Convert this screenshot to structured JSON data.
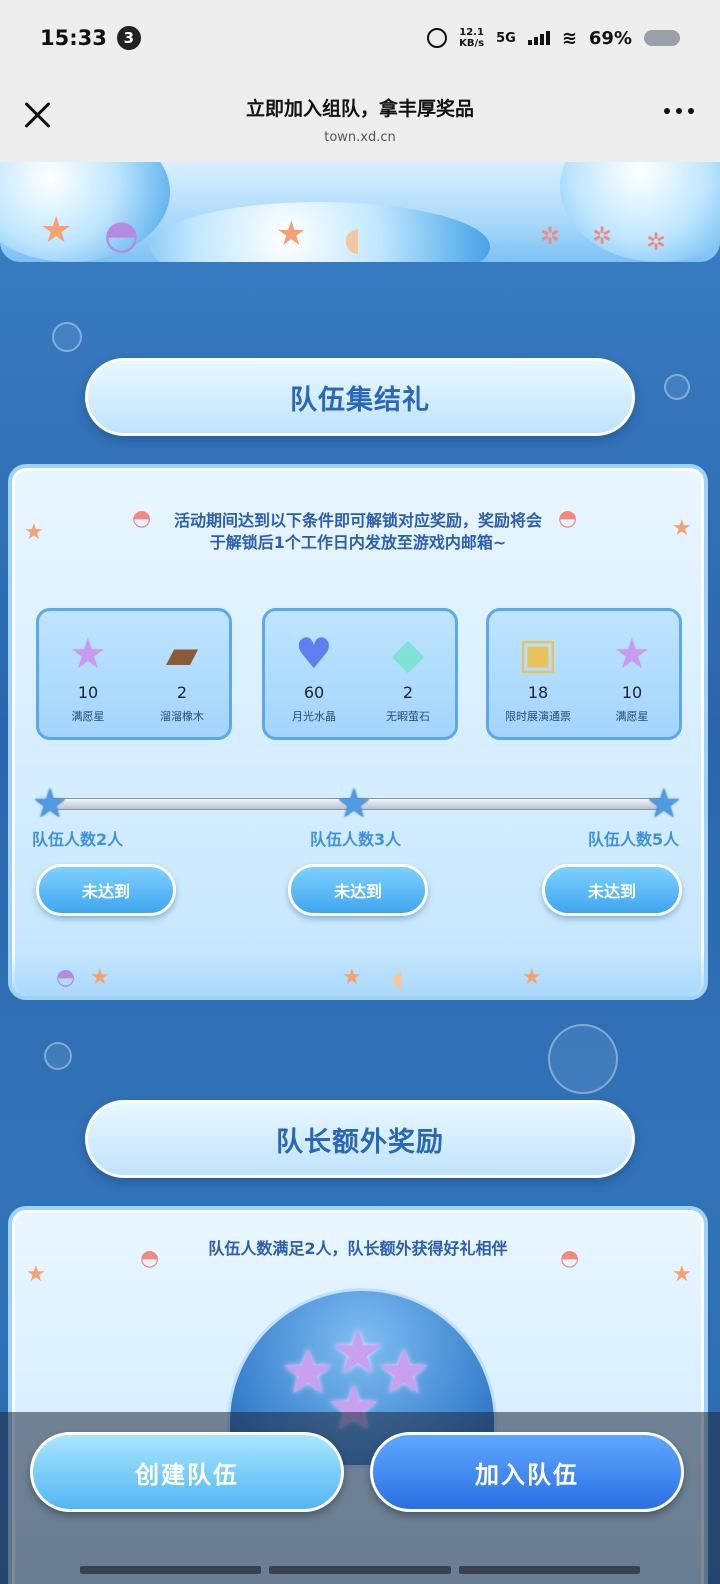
{
  "status_bar": {
    "time": "15:33",
    "notification_count": "3",
    "net_speed_value": "12.1",
    "net_speed_unit": "KB/s",
    "network": "5G",
    "battery": "69%"
  },
  "title_bar": {
    "title": "立即加入组队，拿丰厚奖品",
    "url": "town.xd.cn"
  },
  "gathering_section": {
    "title": "队伍集结礼",
    "description_line1": "活动期间达到以下条件即可解锁对应奖励，奖励将会",
    "description_line2": "于解锁后1个工作日内发放至游戏内邮箱~",
    "tiers": [
      {
        "items": [
          {
            "count": "10",
            "name": "满愿星",
            "icon": "purple-star-icon"
          },
          {
            "count": "2",
            "name": "溜溜橡木",
            "icon": "oak-log-icon"
          }
        ],
        "requirement": "队伍人数2人",
        "status": "未达到"
      },
      {
        "items": [
          {
            "count": "60",
            "name": "月光水晶",
            "icon": "heart-crystal-icon"
          },
          {
            "count": "2",
            "name": "无暇萤石",
            "icon": "gem-icon"
          }
        ],
        "requirement": "队伍人数3人",
        "status": "未达到"
      },
      {
        "items": [
          {
            "count": "18",
            "name": "限时展演通票",
            "icon": "ticket-icon"
          },
          {
            "count": "10",
            "name": "满愿星",
            "icon": "purple-star-icon"
          }
        ],
        "requirement": "队伍人数5人",
        "status": "未达到"
      }
    ]
  },
  "captain_section": {
    "title": "队长额外奖励",
    "description": "队伍人数满足2人，队长额外获得好礼相伴"
  },
  "bottom_actions": {
    "create_label": "创建队伍",
    "join_label": "加入队伍"
  },
  "colors": {
    "page_bg": "#2f6fb6",
    "title_text": "#2a67b4",
    "status_button": "#3ea6ef",
    "join_button": "#2a6fe3"
  }
}
